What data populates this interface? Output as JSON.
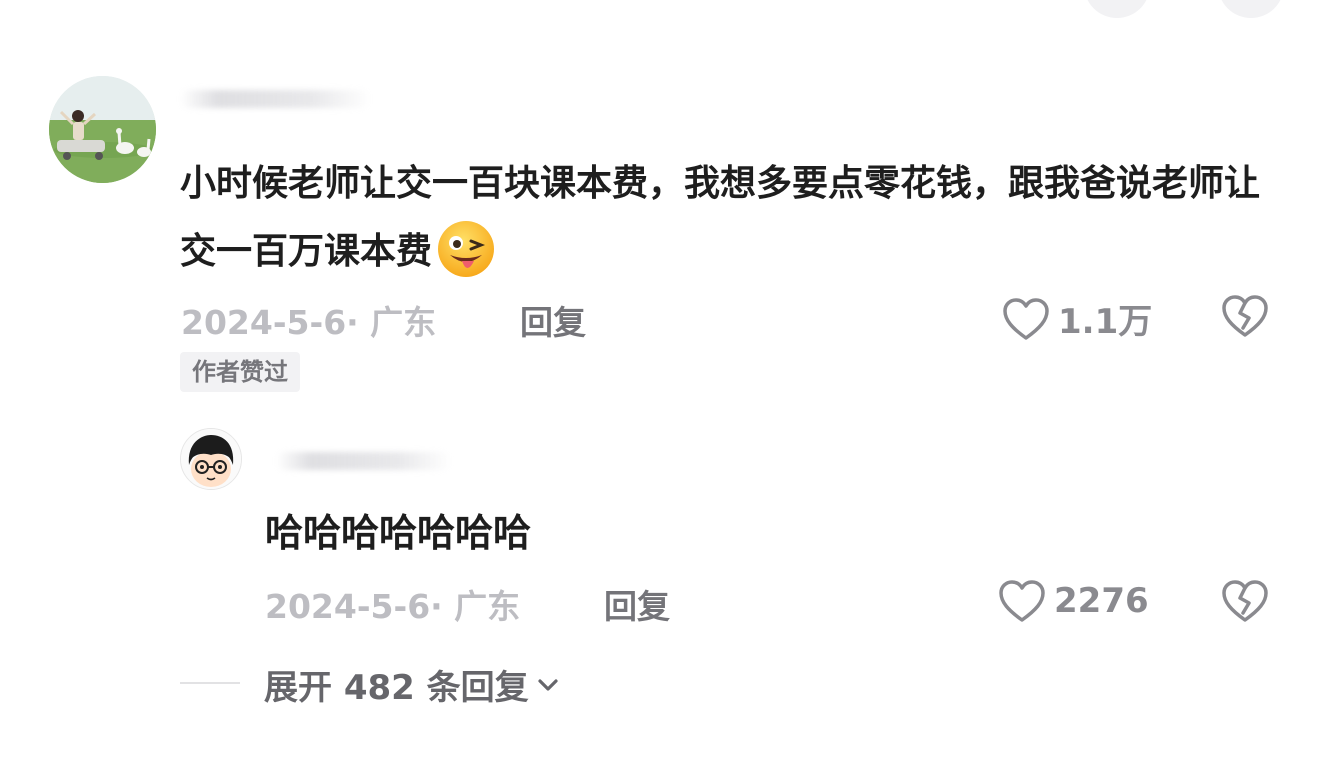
{
  "comment": {
    "text": "小时候老师让交一百块课本费，我想多要点零花钱，跟我爸说老师让交一百万课本费",
    "date_location": "2024-5-6· 广东",
    "reply_label": "回复",
    "like_count": "1.1万",
    "author_badge": "作者赞过"
  },
  "reply": {
    "text": "哈哈哈哈哈哈哈",
    "date_location": "2024-5-6· 广东",
    "reply_label": "回复",
    "like_count": "2276"
  },
  "expand_replies_label": "展开 482 条回复",
  "icons": {
    "like": "heart-outline-icon",
    "dislike": "broken-heart-icon",
    "expand": "chevron-down-icon",
    "emoji": "winking-tongue-emoji"
  },
  "colors": {
    "text_primary": "#1e1e1e",
    "text_meta": "#bdbdc2",
    "text_action": "#747479",
    "icon_gray": "#8a8a8f",
    "badge_bg": "#f2f2f4"
  }
}
